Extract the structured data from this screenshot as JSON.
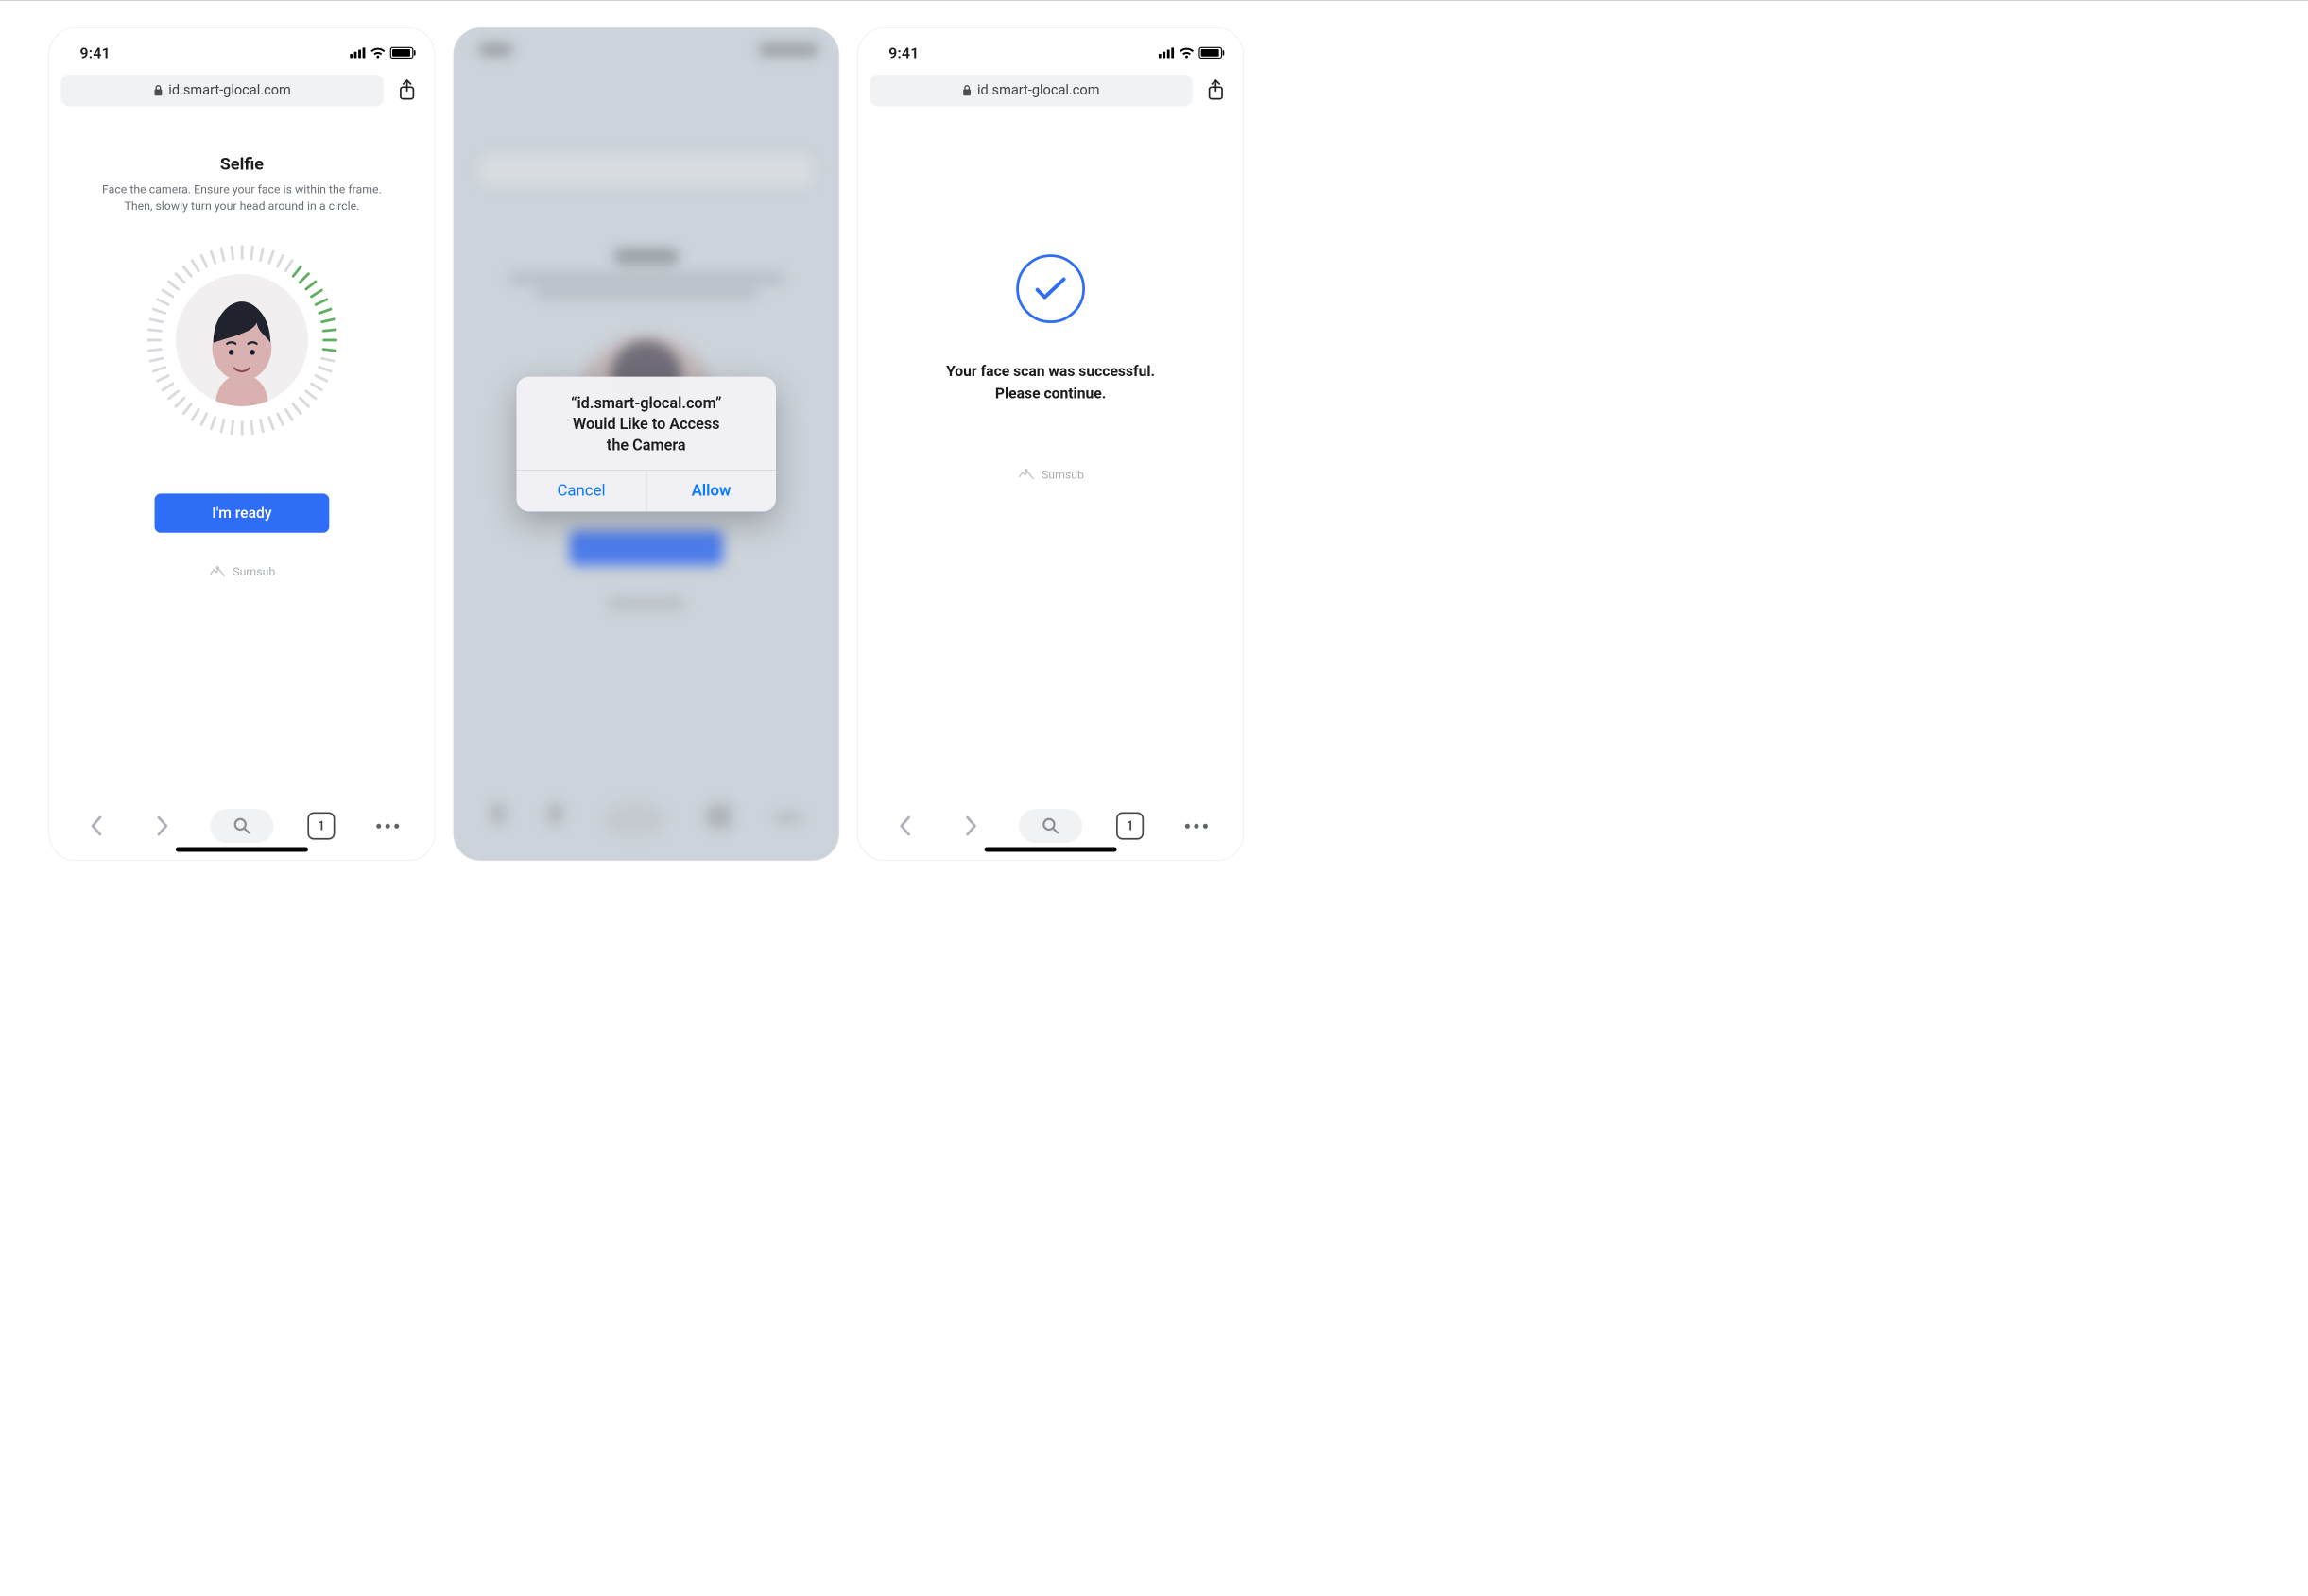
{
  "status": {
    "time": "9:41",
    "tab_count": "1"
  },
  "browser": {
    "url": "id.smart-glocal.com",
    "share_label": "Share"
  },
  "screen1": {
    "title": "Selfie",
    "subtitle_line1": "Face the camera. Ensure your face is within the frame.",
    "subtitle_line2": "Then, slowly turn your head around in a circle.",
    "cta": "I'm ready",
    "provider": "Sumsub"
  },
  "screen2": {
    "alert_line1": "“id.smart-glocal.com”",
    "alert_line2": "Would Like to Access",
    "alert_line3": "the Camera",
    "cancel": "Cancel",
    "allow": "Allow"
  },
  "screen3": {
    "line1": "Your face scan was successful.",
    "line2": "Please continue.",
    "provider": "Sumsub"
  },
  "colors": {
    "primary_button": "#2f6df6",
    "ios_action": "#0a7aff",
    "progress_tick_active": "#5fae62"
  }
}
